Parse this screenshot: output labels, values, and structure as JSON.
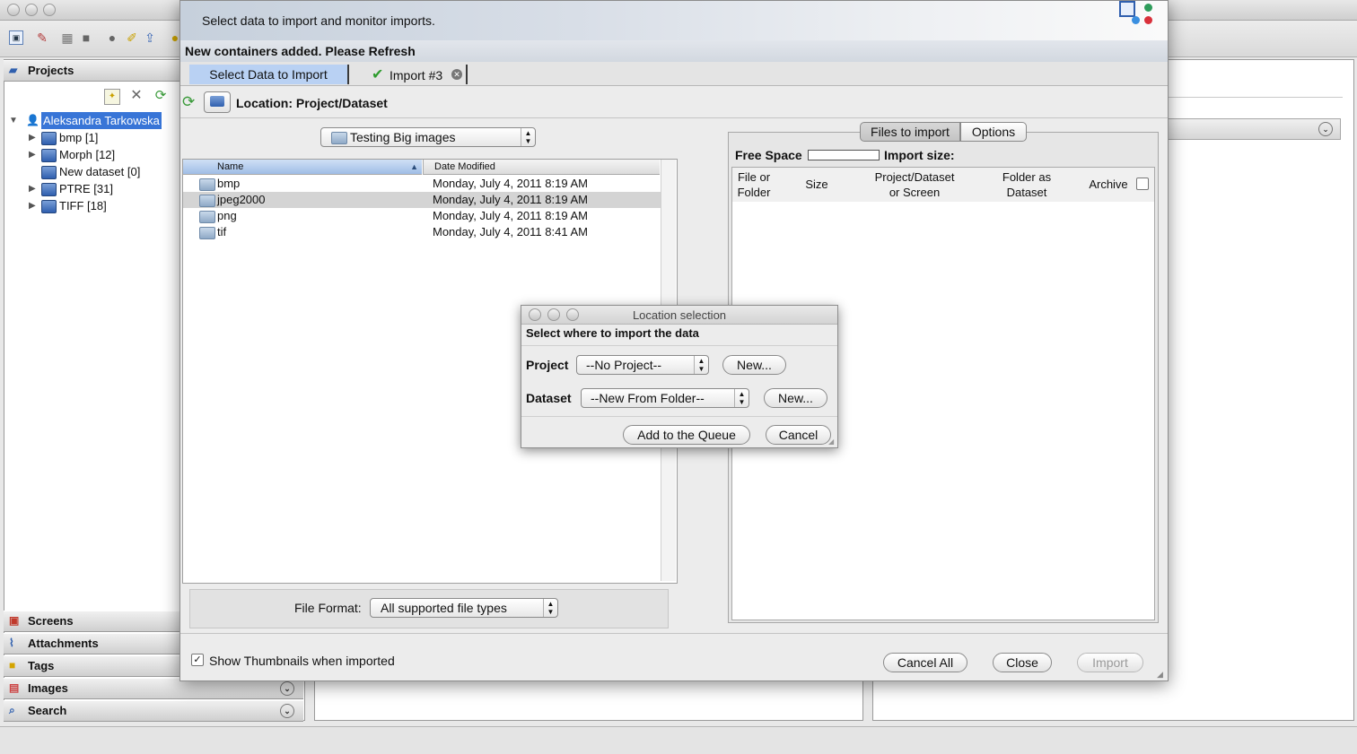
{
  "app": {
    "toolbar_icons": [
      "new-project-icon",
      "edit-icon",
      "grid-icon",
      "grid-dark-icon",
      "search-people-icon",
      "annotate-icon",
      "upload-icon"
    ]
  },
  "left": {
    "projects_header": "Projects",
    "tree": {
      "user": "Aleksandra Tarkowska",
      "items": [
        {
          "label": "bmp [1]",
          "expandable": true
        },
        {
          "label": "Morph [12]",
          "expandable": true
        },
        {
          "label": "New dataset [0]",
          "expandable": false
        },
        {
          "label": "PTRE [31]",
          "expandable": true
        },
        {
          "label": "TIFF [18]",
          "expandable": true
        }
      ]
    },
    "accordion": [
      "Screens",
      "Attachments",
      "Tags",
      "Images",
      "Search"
    ]
  },
  "import_dialog": {
    "banner_text": "Select data to import and monitor imports.",
    "message": "New containers added. Please Refresh",
    "tabs": [
      "Select Data to Import",
      "Import #3"
    ],
    "location_label": "Location: Project/Dataset",
    "folder_combo": "Testing Big images",
    "file_columns": [
      "Name",
      "Date Modified"
    ],
    "files": [
      {
        "name": "bmp",
        "date": "Monday, July 4, 2011 8:19 AM",
        "selected": false
      },
      {
        "name": "jpeg2000",
        "date": "Monday, July 4, 2011 8:19 AM",
        "selected": true
      },
      {
        "name": "png",
        "date": "Monday, July 4, 2011 8:19 AM",
        "selected": false
      },
      {
        "name": "tif",
        "date": "Monday, July 4, 2011 8:41 AM",
        "selected": false
      }
    ],
    "file_format_label": "File Format:",
    "file_format_value": "All supported file types",
    "right_tabs": [
      "Files to import",
      "Options"
    ],
    "free_space_label": "Free Space",
    "import_size_label": "Import size:",
    "table_headers": [
      "File or\nFolder",
      "Size",
      "Project/Dataset\nor Screen",
      "Folder as\nDataset",
      "Archive"
    ],
    "show_thumbnails_label": "Show Thumbnails when imported",
    "show_thumbnails_checked": true,
    "buttons": {
      "cancel_all": "Cancel All",
      "close": "Close",
      "import": "Import"
    }
  },
  "location_dialog": {
    "title": "Location selection",
    "heading": "Select where to import the data",
    "project_label": "Project",
    "project_value": "--No Project--",
    "dataset_label": "Dataset",
    "dataset_value": "--New From Folder--",
    "new_label": "New...",
    "add_to_queue": "Add to the Queue",
    "cancel": "Cancel"
  },
  "colors": {
    "selection_blue": "#3875d7",
    "tab_selected": "#b9d1f3",
    "green_check": "#2e9c2e"
  }
}
